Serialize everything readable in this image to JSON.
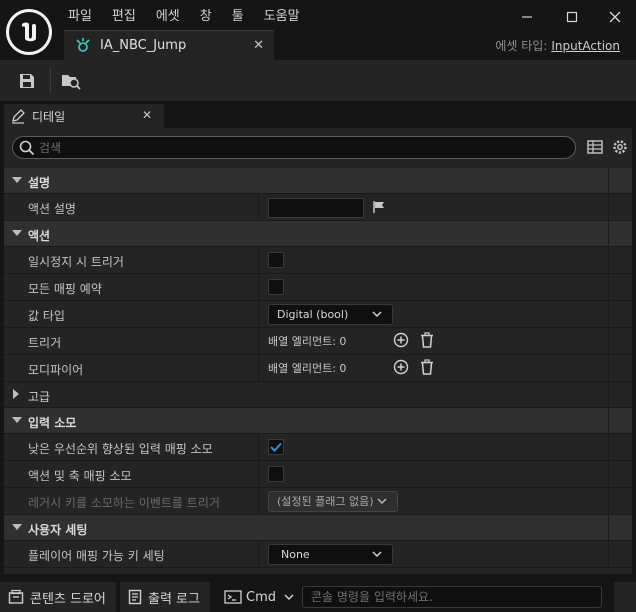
{
  "menu": [
    "파일",
    "편집",
    "에셋",
    "창",
    "툴",
    "도움말"
  ],
  "asset_type": {
    "label": "에셋 타입:",
    "value": "InputAction"
  },
  "document_tab": {
    "label": "IA_NBC_Jump"
  },
  "details_tab": {
    "label": "디테일"
  },
  "search": {
    "placeholder": "검색"
  },
  "sections": {
    "description": {
      "title": "설명",
      "action_description": {
        "label": "액션 설명",
        "value": ""
      }
    },
    "action": {
      "title": "액션",
      "trigger_when_paused": {
        "label": "일시정지 시 트리거",
        "checked": false
      },
      "reserve_all_mappings": {
        "label": "모든 매핑 예약",
        "checked": false
      },
      "value_type": {
        "label": "값 타입",
        "value": "Digital (bool)"
      },
      "triggers": {
        "label": "트리거",
        "count_text": "배열 엘리먼트: 0"
      },
      "modifiers": {
        "label": "모디파이어",
        "count_text": "배열 엘리먼트: 0"
      }
    },
    "advanced": {
      "title": "고급"
    },
    "input_consumption": {
      "title": "입력 소모",
      "consume_lower_priority": {
        "label": "낮은 우선순위 향상된 입력 매핑 소모",
        "checked": true
      },
      "consume_action_axis": {
        "label": "액션 및 축 매핑 소모",
        "checked": false
      },
      "legacy_trigger": {
        "label": "레거시 키를 소모하는 이벤트를 트리거",
        "value": "(설정된 플래그 없음)"
      }
    },
    "user_settings": {
      "title": "사용자 세팅",
      "player_mappable": {
        "label": "플레이어 매핑 가능 키 세팅",
        "value": "None"
      }
    }
  },
  "bottom": {
    "content_drawer": "콘텐츠 드로어",
    "output_log": "출력 로그",
    "cmd": "Cmd",
    "console_placeholder": "콘솔 명령을 입력하세요."
  },
  "colors": {
    "accent": "#2a8cff",
    "panel": "#242424",
    "background": "#151515"
  }
}
